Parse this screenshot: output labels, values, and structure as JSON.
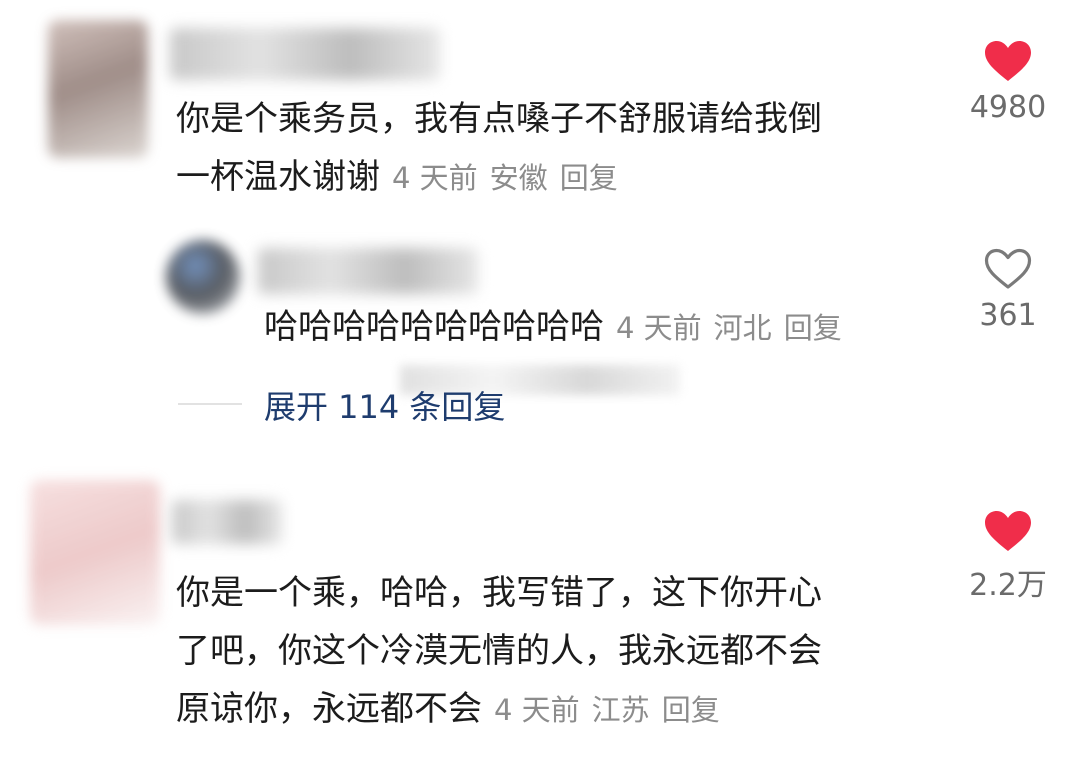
{
  "comments": [
    {
      "text_lines": [
        "你是个乘务员，我有点嗓子不舒服请给我倒",
        "一杯温水谢谢"
      ],
      "time": "4 天前",
      "location": "安徽",
      "reply_label": "回复",
      "likes": "4980",
      "liked": true
    },
    {
      "text_lines": [
        "哈哈哈哈哈哈哈哈哈哈"
      ],
      "time": "4 天前",
      "location": "河北",
      "reply_label": "回复",
      "likes": "361",
      "liked": false
    },
    {
      "text_lines": [
        "你是一个乘，哈哈，我写错了，这下你开心",
        "了吧，你这个冷漠无情的人，我永远都不会",
        "原谅你，永远都不会"
      ],
      "time": "4 天前",
      "location": "江苏",
      "reply_label": "回复",
      "likes": "2.2万",
      "liked": true
    }
  ],
  "expand_replies": "展开 114 条回复",
  "colors": {
    "heart_liked": "#f02d4a",
    "heart_outline": "#7a7a7a",
    "expand_link": "#1e3c6e",
    "meta_gray": "#8c8c8c"
  }
}
